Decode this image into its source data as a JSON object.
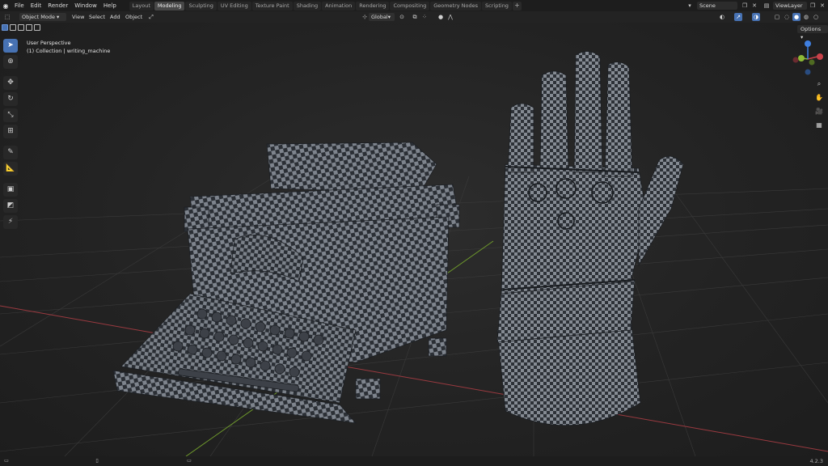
{
  "menu": [
    "File",
    "Edit",
    "Render",
    "Window",
    "Help"
  ],
  "tabs": [
    "Layout",
    "Modeling",
    "Sculpting",
    "UV Editing",
    "Texture Paint",
    "Shading",
    "Animation",
    "Rendering",
    "Compositing",
    "Geometry Nodes",
    "Scripting"
  ],
  "active_tab": "Modeling",
  "scene": "Scene",
  "view_layer": "ViewLayer",
  "header": {
    "mode": "Object Mode",
    "menus": [
      "View",
      "Select",
      "Add",
      "Object"
    ],
    "transform_orientation": "Global"
  },
  "viewport": {
    "view_name": "User Perspective",
    "collection_line": "(1) Collection | writing_machine"
  },
  "options_label": "Options",
  "version": "4.2.3",
  "colors": {
    "accent": "#4772b3",
    "axis_x": "#c8424a",
    "axis_y": "#8dba36",
    "axis_z": "#3f7fe0"
  }
}
